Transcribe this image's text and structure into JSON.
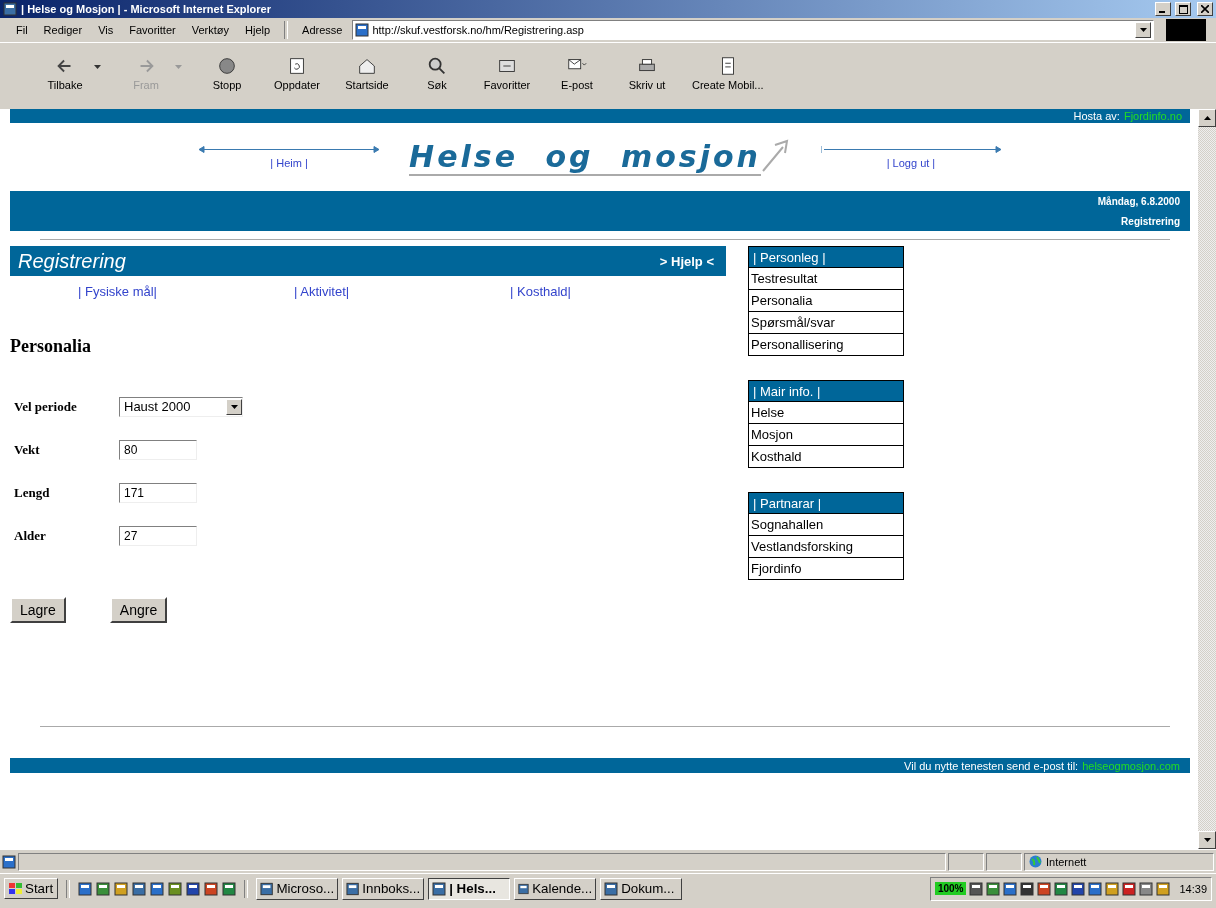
{
  "window": {
    "title": "| Helse og Mosjon | - Microsoft Internet Explorer"
  },
  "menu": [
    "Fil",
    "Rediger",
    "Vis",
    "Favoritter",
    "Verktøy",
    "Hjelp"
  ],
  "address": {
    "label": "Adresse",
    "value": "http://skuf.vestforsk.no/hm/Registrering.asp"
  },
  "toolbar": [
    {
      "label": "Tilbake",
      "kind": "back",
      "disabled": false,
      "dropdown": true
    },
    {
      "label": "Fram",
      "kind": "forward",
      "disabled": true,
      "dropdown": true
    },
    {
      "label": "Stopp",
      "kind": "stop",
      "disabled": false,
      "dropdown": false
    },
    {
      "label": "Oppdater",
      "kind": "refresh",
      "disabled": false,
      "dropdown": false
    },
    {
      "label": "Startside",
      "kind": "home",
      "disabled": false,
      "dropdown": false
    },
    {
      "label": "Søk",
      "kind": "search",
      "disabled": false,
      "dropdown": false
    },
    {
      "label": "Favoritter",
      "kind": "favorites",
      "disabled": false,
      "dropdown": false
    },
    {
      "label": "E-post",
      "kind": "mail",
      "disabled": false,
      "dropdown": false
    },
    {
      "label": "Skriv ut",
      "kind": "print",
      "disabled": false,
      "dropdown": false
    },
    {
      "label": "Create Mobil...",
      "kind": "page",
      "disabled": false,
      "dropdown": false
    }
  ],
  "page": {
    "hosted_by": "Hosta av:",
    "host_link": "Fjordinfo.no",
    "nav_left": "| Heim |",
    "logo": "Helse og mosjon",
    "nav_right": "| Logg ut |",
    "date": "Måndag, 6.8.2000",
    "section": "Registrering",
    "panel_title": "Registrering",
    "help": "> Hjelp <",
    "tabs": [
      "| Fysiske mål|",
      "| Aktivitet|",
      "| Kosthald|"
    ],
    "heading": "Personalia",
    "fields": [
      {
        "label": "Vel periode",
        "kind": "select",
        "value": "Haust 2000"
      },
      {
        "label": "Vekt",
        "kind": "text",
        "value": "80"
      },
      {
        "label": "Lengd",
        "kind": "text",
        "value": "171"
      },
      {
        "label": "Alder",
        "kind": "text",
        "value": "27"
      }
    ],
    "buttons": [
      "Lagre",
      "Angre"
    ],
    "menus": [
      {
        "title": "| Personleg |",
        "items": [
          "Testresultat",
          "Personalia",
          "Spørsmål/svar",
          "Personallisering"
        ]
      },
      {
        "title": "| Mair info. |",
        "items": [
          "Helse",
          "Mosjon",
          "Kosthald"
        ]
      },
      {
        "title": "| Partnarar |",
        "items": [
          "Sognahallen",
          "Vestlandsforsking",
          "Fjordinfo"
        ]
      }
    ],
    "footer_text": "Vil du nytte tenesten send e-post til:",
    "footer_link": "helseogmosjon.com"
  },
  "status_bar": {
    "zone": "Internett"
  },
  "taskbar": {
    "start": "Start",
    "tasks": [
      {
        "label": "Microso...",
        "selected": false
      },
      {
        "label": "Innboks...",
        "selected": false
      },
      {
        "label": "| Hels...",
        "selected": true
      },
      {
        "label": "Kalende...",
        "selected": false
      },
      {
        "label": "Dokum...",
        "selected": false
      }
    ],
    "battery": "100%",
    "clock": "14:39"
  }
}
